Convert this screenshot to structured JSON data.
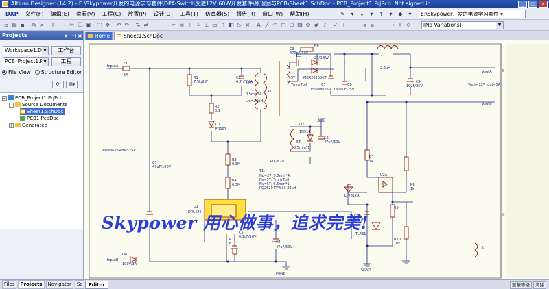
{
  "window": {
    "title": "Altium Designer (14.2) - E:\\Skypower开发的电源学习套件\\DPA-Switch反激12V 60W开发套件\\原理图与PCB\\Sheet1.SchDoc - PCB_Project1.PrjPcb. Not signed in."
  },
  "menu": {
    "dxp": "DXP",
    "items": [
      "文件(F)",
      "编辑(E)",
      "察看(V)",
      "工程(C)",
      "放置(P)",
      "设计(D)",
      "工具(T)",
      "仿真器(S)",
      "报告(R)",
      "窗口(W)",
      "帮助(H)"
    ]
  },
  "toolbar": {
    "path": "E:\\Skypower开发的电源学习套件 ▾",
    "variations": "[No Variations]"
  },
  "projects_panel": {
    "title": "Projects",
    "workspace": "Workspace1.Dsn'",
    "workspace_btn": "工作台",
    "project": "PCB_Project1.PrjPcb",
    "project_btn": "工程",
    "file_view": "File View",
    "structure_editor": "Structure Editor",
    "tree": {
      "project": "PCB_Project1.PrjPcb",
      "source_documents": "Source Documents",
      "sheet": "Sheet1.SchDoc",
      "pcb": "PCB1.PcbDoc",
      "generated": "Generated"
    }
  },
  "bottom_tabs": [
    "Files",
    "Projects",
    "Navigator",
    "Sc"
  ],
  "doc_tabs": {
    "home": "Home",
    "sheet": "Sheet1.SchDoc"
  },
  "editor_tab": "Editor",
  "status_buttons": [
    "遮蔽等级",
    "清除"
  ],
  "schematic": {
    "labels": {
      "inputA": "InputA",
      "f1": "F1",
      "f1v": "5A",
      "r1": "R1",
      "r1v": "7.5k/2W",
      "c2": "C2",
      "c2v": "4.7nF/1kV",
      "r2": "R2",
      "r2v": "5.1",
      "d1": "D1",
      "d1v": "FR107",
      "c3": "C3",
      "c3v": "470pF/1kV",
      "r6": "R6",
      "r6v": "22/0.5W",
      "d3": "D3",
      "d3v": "MBR20200CT",
      "c7": "C7",
      "c7v": "1500uF/25V",
      "c8": "C8",
      "c8v": "1500uF/25V",
      "l1": "L1",
      "l1v": "2.2uH",
      "c9": "C9",
      "c9v": "10uF/25V",
      "voutA": "VoutA",
      "voutB": "VoutB",
      "vout_note": "Vout=12V Iout=5A",
      "t1": "T1",
      "t1a": "11T",
      "t1b": "0.5mm*4",
      "t1c": "Lm=23uH",
      "t1d": "5T",
      "t1e": "7mm Foil",
      "d2": "D2",
      "d2v": "1N914",
      "vcc": "VCC",
      "c6": "C6",
      "c6v": "47uF/50V",
      "t1f": "5T",
      "t1g": "0.5mm*1",
      "pq": "PQ2620",
      "vin_note": "Vin=36V~48V~75V",
      "c1": "C1",
      "c1v": "47uF/100V",
      "r3": "R3",
      "r3v": "0.3M",
      "r4": "R4",
      "r4v": "0.3M",
      "note_t1": "T1:",
      "note1": "Np=27, 0.5mm*4",
      "note2": "Ns=5T, 7mm Foil",
      "note3": "Nv=5T, 0.5mm*1",
      "note4": "PQ2620 TPW33 23uH",
      "u1": "U1",
      "u1v": "DPA426",
      "c5": "C5",
      "c5v": "0.1uF/16V",
      "r11": "R11",
      "r11v": "6",
      "c4": "C4",
      "c4v": "47uF/50V",
      "r7": "R7",
      "r7v": "1k",
      "r8": "R8",
      "r8v": "1k",
      "u2a": "U2A",
      "u2av": "LTV817A",
      "r9": "R9",
      "r9v": "",
      "c10": "C10",
      "c10v": "0.1uF",
      "tl431": "TL431",
      "r10": "R10",
      "r10v": "10k",
      "d4": "D4",
      "d4v": "100V/3A",
      "inputB": "InputB",
      "pgnd": "PGND",
      "sgnd": "SGND",
      "border_b": "B",
      "border_c": "C",
      "border_2": "2"
    }
  },
  "watermark": "Skypower 用心做事，追求完美!"
}
